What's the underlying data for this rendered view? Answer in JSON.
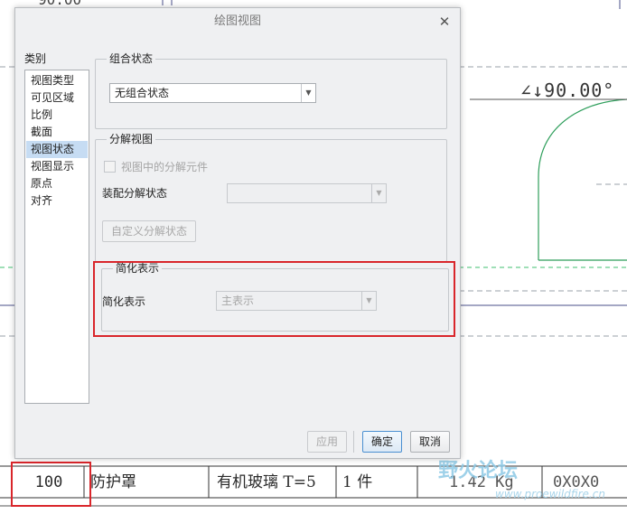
{
  "drawing": {
    "top_partial_text": "90.00",
    "angle_annotation": "∠↓90.00°",
    "bom_row": {
      "quantity": "100",
      "name": "防护罩",
      "material": "有机玻璃 T=5",
      "unit": "1 件",
      "weight": "1.42 Kg",
      "dimension": "0X0X0"
    },
    "watermark": {
      "logo_text": "野火论坛",
      "url": "www.proewildfire.cn"
    }
  },
  "dialog": {
    "title": "绘图视图",
    "category_label": "类别",
    "categories": [
      "视图类型",
      "可见区域",
      "比例",
      "截面",
      "视图状态",
      "视图显示",
      "原点",
      "对齐"
    ],
    "selected_category": "视图状态",
    "combo_state": {
      "group_title": "组合状态",
      "value": "无组合状态"
    },
    "exploded_view": {
      "group_title": "分解视图",
      "checkbox_label": "视图中的分解元件",
      "assembly_label": "装配分解状态",
      "assembly_value": "",
      "custom_button": "自定义分解状态"
    },
    "simplified_rep": {
      "group_title": "简化表示",
      "label": "简化表示",
      "value": "主表示"
    },
    "buttons": {
      "apply": "应用",
      "ok": "确定",
      "cancel": "取消"
    }
  },
  "colors": {
    "highlight_red": "#d9262b",
    "selection_blue": "#c6dcf3",
    "cad_green": "#2e9e5b"
  }
}
